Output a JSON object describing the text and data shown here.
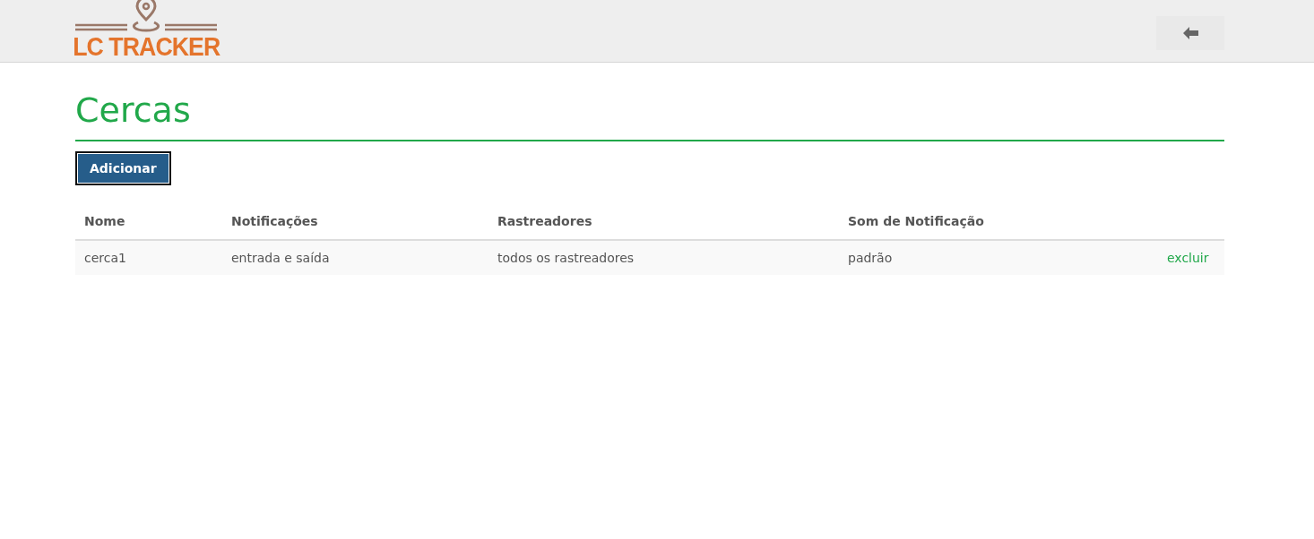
{
  "header": {
    "logo_text": "LC TRACKER"
  },
  "page": {
    "title": "Cercas",
    "add_button": "Adicionar"
  },
  "table": {
    "columns": [
      "Nome",
      "Notificações",
      "Rastreadores",
      "Som de Notificação"
    ],
    "rows": [
      {
        "cells": [
          "cerca1",
          "entrada e saída",
          "todos os rastreadores",
          "padrão"
        ],
        "action": "excluir"
      }
    ]
  }
}
